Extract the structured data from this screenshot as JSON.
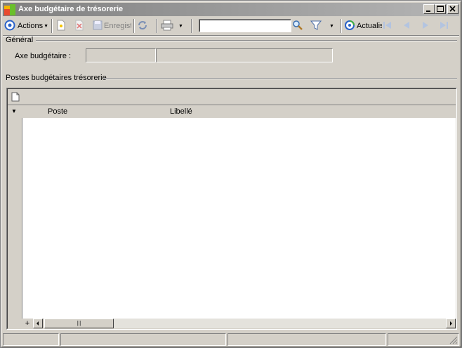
{
  "window": {
    "title": "Axe budgétaire de trésorerie"
  },
  "toolbar": {
    "actions_label": "Actions",
    "save_label": "Enregist",
    "search_value": "",
    "refresh_label": "Actualis"
  },
  "general": {
    "title": "Général",
    "axis_label": "Axe budgétaire :",
    "axis_code": "",
    "axis_name": ""
  },
  "postes": {
    "title": "Postes budgétaires trésorerie",
    "columns": [
      "Poste",
      "Libellé"
    ],
    "rows": []
  },
  "grid": {
    "add_symbol": "+",
    "thumb_grip": "|||"
  },
  "statusbar": {
    "cells": [
      "",
      "",
      "",
      ""
    ]
  },
  "icons": {
    "actions": "actions-circle-icon",
    "new": "new-document-icon",
    "delete": "delete-icon",
    "save": "save-icon",
    "sync": "sync-icon",
    "print": "print-icon",
    "search": "magnifier-icon",
    "filter": "funnel-icon",
    "refresh": "refresh-icon",
    "nav_first": "first-record-icon",
    "nav_prev": "previous-record-icon",
    "nav_next": "next-record-icon",
    "nav_last": "last-record-icon"
  }
}
